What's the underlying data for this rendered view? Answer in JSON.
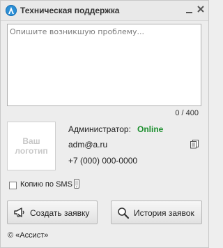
{
  "window": {
    "title": "Техническая поддержка"
  },
  "problem": {
    "placeholder": "Опишите возникшую проблему...",
    "counter": "0 / 400"
  },
  "company_logo": {
    "text": "Ваш\nлоготип"
  },
  "admin": {
    "label": "Администратор:",
    "status": "Online",
    "email": "adm@a.ru",
    "phone": "+7 (000) 000-0000"
  },
  "sms": {
    "label": "Копию по SMS",
    "checked": false
  },
  "buttons": {
    "create": "Создать заявку",
    "history": "История заявок"
  },
  "footer": {
    "copyright": "© «Ассист»"
  },
  "colors": {
    "status_online": "#1c8f2e",
    "logo_blue": "#2b8fd6"
  },
  "icons": {
    "title": "assist-logo-icon",
    "copy": "copy-icon",
    "phone": "mobile-phone-icon",
    "create": "megaphone-icon",
    "history": "search-icon"
  }
}
